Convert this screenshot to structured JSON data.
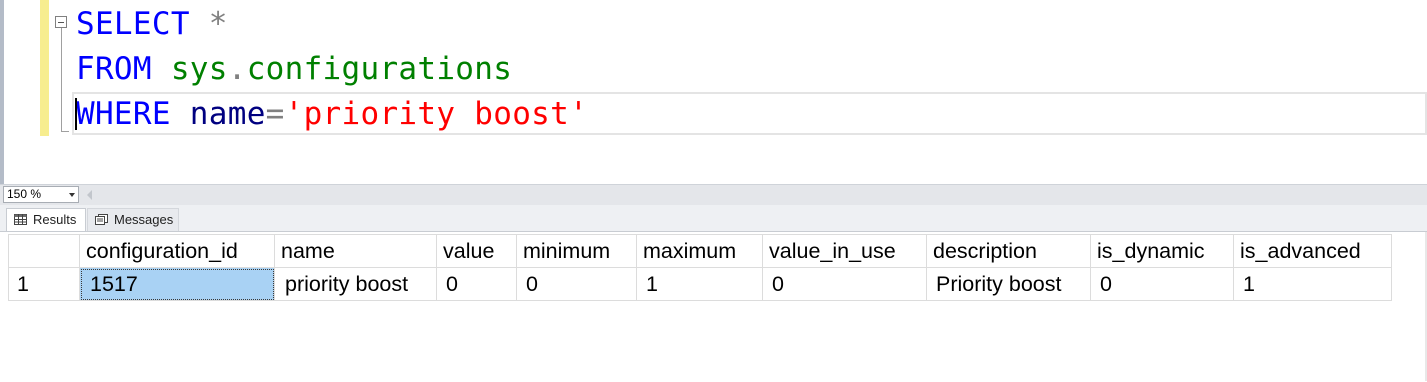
{
  "editor": {
    "lines": [
      [
        {
          "text": "SELECT",
          "cls": "kw"
        },
        {
          "text": " ",
          "cls": ""
        },
        {
          "text": "*",
          "cls": "gray"
        }
      ],
      [
        {
          "text": "FROM",
          "cls": "kw"
        },
        {
          "text": " ",
          "cls": ""
        },
        {
          "text": "sys",
          "cls": "green"
        },
        {
          "text": ".",
          "cls": "gray"
        },
        {
          "text": "configurations",
          "cls": "green"
        }
      ],
      [
        {
          "text": "WHERE",
          "cls": "kw"
        },
        {
          "text": " ",
          "cls": ""
        },
        {
          "text": "name",
          "cls": "ident"
        },
        {
          "text": "=",
          "cls": "gray"
        },
        {
          "text": "'priority boost'",
          "cls": "str"
        }
      ]
    ]
  },
  "zoom": {
    "value": "150 %"
  },
  "tabs": {
    "results_label": "Results",
    "messages_label": "Messages"
  },
  "grid": {
    "columns": [
      "configuration_id",
      "name",
      "value",
      "minimum",
      "maximum",
      "value_in_use",
      "description",
      "is_dynamic",
      "is_advanced"
    ],
    "rows": [
      {
        "num": "1",
        "cells": [
          "1517",
          "priority boost",
          "0",
          "0",
          "1",
          "0",
          "Priority boost",
          "0",
          "1"
        ]
      }
    ]
  },
  "colors": {
    "keyword": "#0000ff",
    "object": "#008000",
    "string": "#ff0000",
    "selected_cell": "#a9d2f4",
    "change_bar": "#f7ed8f"
  }
}
